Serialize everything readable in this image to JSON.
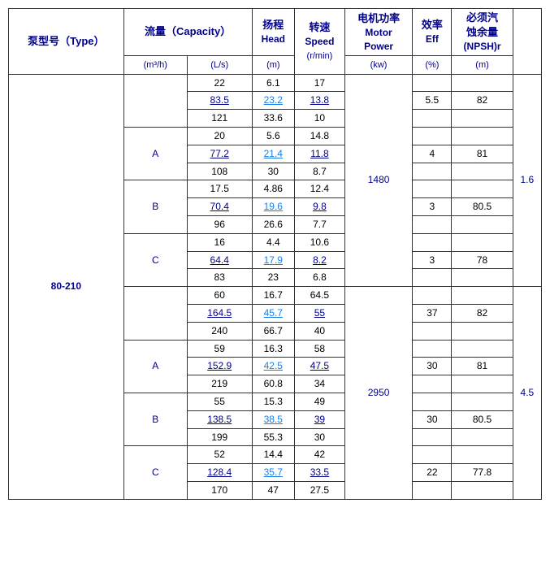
{
  "table": {
    "headers": {
      "col1": {
        "zh": "泵型号（Type）"
      },
      "col2": {
        "zh": "流量（Capacity）"
      },
      "col2a": {
        "unit": "(m³/h)"
      },
      "col2b": {
        "unit": "(L/s)"
      },
      "col3": {
        "zh": "扬程",
        "en": "Head",
        "unit": "(m)"
      },
      "col4": {
        "zh": "转速",
        "en": "Speed",
        "unit": "(r/min)"
      },
      "col5": {
        "zh": "电机功率",
        "en": "Motor Power",
        "unit": "(kw)"
      },
      "col6": {
        "zh": "效率",
        "en": "Eff",
        "unit": "(%)"
      },
      "col7": {
        "zh": "必须汽蚀余量",
        "en": "(NPSH)r",
        "unit": "(m)"
      }
    },
    "pump_type": "80-210",
    "groups": [
      {
        "variant": "",
        "speed_group": "1480",
        "npsh": "1.6",
        "rows": [
          {
            "flow_m3h": "22",
            "flow_ls": "6.1",
            "head": "17",
            "motor": "",
            "eff": ""
          },
          {
            "flow_m3h": "83.5",
            "flow_ls": "23.2",
            "head": "13.8",
            "motor": "5.5",
            "eff": "82"
          },
          {
            "flow_m3h": "121",
            "flow_ls": "33.6",
            "head": "10",
            "motor": "",
            "eff": ""
          }
        ]
      },
      {
        "variant": "A",
        "speed_group": "",
        "npsh": "",
        "rows": [
          {
            "flow_m3h": "20",
            "flow_ls": "5.6",
            "head": "14.8",
            "motor": "",
            "eff": ""
          },
          {
            "flow_m3h": "77.2",
            "flow_ls": "21.4",
            "head": "11.8",
            "motor": "4",
            "eff": "81"
          },
          {
            "flow_m3h": "108",
            "flow_ls": "30",
            "head": "8.7",
            "motor": "",
            "eff": ""
          }
        ]
      },
      {
        "variant": "B",
        "speed_group": "",
        "npsh": "",
        "rows": [
          {
            "flow_m3h": "17.5",
            "flow_ls": "4.86",
            "head": "12.4",
            "motor": "",
            "eff": ""
          },
          {
            "flow_m3h": "70.4",
            "flow_ls": "19.6",
            "head": "9.8",
            "motor": "3",
            "eff": "80.5"
          },
          {
            "flow_m3h": "96",
            "flow_ls": "26.6",
            "head": "7.7",
            "motor": "",
            "eff": ""
          }
        ]
      },
      {
        "variant": "C",
        "speed_group": "",
        "npsh": "",
        "rows": [
          {
            "flow_m3h": "16",
            "flow_ls": "4.4",
            "head": "10.6",
            "motor": "",
            "eff": ""
          },
          {
            "flow_m3h": "64.4",
            "flow_ls": "17.9",
            "head": "8.2",
            "motor": "3",
            "eff": "78"
          },
          {
            "flow_m3h": "83",
            "flow_ls": "23",
            "head": "6.8",
            "motor": "",
            "eff": ""
          }
        ]
      },
      {
        "variant": "",
        "speed_group": "2950",
        "npsh": "4.5",
        "rows": [
          {
            "flow_m3h": "60",
            "flow_ls": "16.7",
            "head": "64.5",
            "motor": "",
            "eff": ""
          },
          {
            "flow_m3h": "164.5",
            "flow_ls": "45.7",
            "head": "55",
            "motor": "37",
            "eff": "82"
          },
          {
            "flow_m3h": "240",
            "flow_ls": "66.7",
            "head": "40",
            "motor": "",
            "eff": ""
          }
        ]
      },
      {
        "variant": "A",
        "speed_group": "",
        "npsh": "",
        "rows": [
          {
            "flow_m3h": "59",
            "flow_ls": "16.3",
            "head": "58",
            "motor": "",
            "eff": ""
          },
          {
            "flow_m3h": "152.9",
            "flow_ls": "42.5",
            "head": "47.5",
            "motor": "30",
            "eff": "81"
          },
          {
            "flow_m3h": "219",
            "flow_ls": "60.8",
            "head": "34",
            "motor": "",
            "eff": ""
          }
        ]
      },
      {
        "variant": "B",
        "speed_group": "",
        "npsh": "",
        "rows": [
          {
            "flow_m3h": "55",
            "flow_ls": "15.3",
            "head": "49",
            "motor": "",
            "eff": ""
          },
          {
            "flow_m3h": "138.5",
            "flow_ls": "38.5",
            "head": "39",
            "motor": "30",
            "eff": "80.5"
          },
          {
            "flow_m3h": "199",
            "flow_ls": "55.3",
            "head": "30",
            "motor": "",
            "eff": ""
          }
        ]
      },
      {
        "variant": "C",
        "speed_group": "",
        "npsh": "",
        "rows": [
          {
            "flow_m3h": "52",
            "flow_ls": "14.4",
            "head": "42",
            "motor": "",
            "eff": ""
          },
          {
            "flow_m3h": "128.4",
            "flow_ls": "35.7",
            "head": "33.5",
            "motor": "22",
            "eff": "77.8"
          },
          {
            "flow_m3h": "170",
            "flow_ls": "47",
            "head": "27.5",
            "motor": "",
            "eff": ""
          }
        ]
      }
    ]
  }
}
